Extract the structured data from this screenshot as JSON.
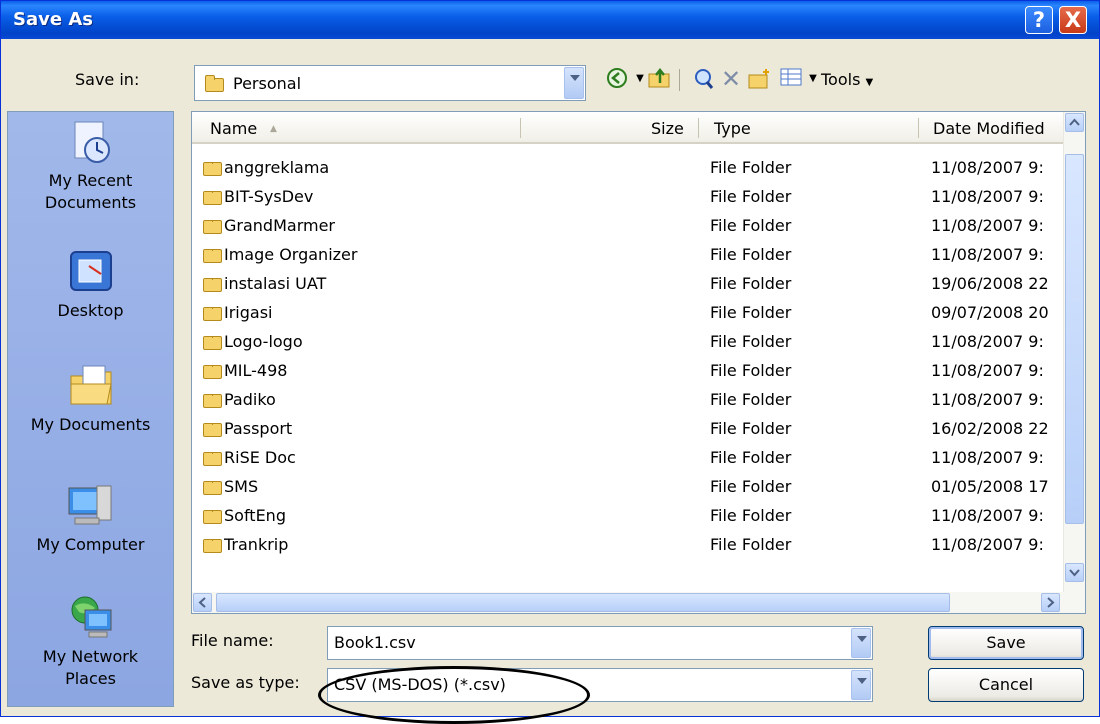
{
  "window": {
    "title": "Save As",
    "help_label": "?",
    "close_label": "X"
  },
  "toolbar": {
    "save_in_label": "Save in:",
    "save_in_value": "Personal",
    "tools_label": "Tools"
  },
  "places": [
    {
      "label_line1": "My Recent",
      "label_line2": "Documents",
      "icon": "recent-documents-icon"
    },
    {
      "label_line1": "Desktop",
      "label_line2": "",
      "icon": "desktop-icon"
    },
    {
      "label_line1": "My Documents",
      "label_line2": "",
      "icon": "my-documents-icon"
    },
    {
      "label_line1": "My Computer",
      "label_line2": "",
      "icon": "my-computer-icon"
    },
    {
      "label_line1": "My Network",
      "label_line2": "Places",
      "icon": "network-places-icon"
    }
  ],
  "list": {
    "columns": {
      "name": "Name",
      "size": "Size",
      "type": "Type",
      "date": "Date Modified"
    },
    "rows": [
      {
        "name": "anggreklama",
        "size": "",
        "type": "File Folder",
        "date": "11/08/2007 9:"
      },
      {
        "name": "BIT-SysDev",
        "size": "",
        "type": "File Folder",
        "date": "11/08/2007 9:"
      },
      {
        "name": "GrandMarmer",
        "size": "",
        "type": "File Folder",
        "date": "11/08/2007 9:"
      },
      {
        "name": "Image Organizer",
        "size": "",
        "type": "File Folder",
        "date": "11/08/2007 9:"
      },
      {
        "name": "instalasi UAT",
        "size": "",
        "type": "File Folder",
        "date": "19/06/2008 22"
      },
      {
        "name": "Irigasi",
        "size": "",
        "type": "File Folder",
        "date": "09/07/2008 20"
      },
      {
        "name": "Logo-logo",
        "size": "",
        "type": "File Folder",
        "date": "11/08/2007 9:"
      },
      {
        "name": "MIL-498",
        "size": "",
        "type": "File Folder",
        "date": "11/08/2007 9:"
      },
      {
        "name": "Padiko",
        "size": "",
        "type": "File Folder",
        "date": "11/08/2007 9:"
      },
      {
        "name": "Passport",
        "size": "",
        "type": "File Folder",
        "date": "16/02/2008 22"
      },
      {
        "name": "RiSE Doc",
        "size": "",
        "type": "File Folder",
        "date": "11/08/2007 9:"
      },
      {
        "name": "SMS",
        "size": "",
        "type": "File Folder",
        "date": "01/05/2008 17"
      },
      {
        "name": "SoftEng",
        "size": "",
        "type": "File Folder",
        "date": "11/08/2007 9:"
      },
      {
        "name": "Trankrip",
        "size": "",
        "type": "File Folder",
        "date": "11/08/2007 9:"
      }
    ]
  },
  "form": {
    "file_name_label": "File name:",
    "file_name_value": "Book1.csv",
    "save_type_label": "Save as type:",
    "save_type_value": "CSV (MS-DOS) (*.csv)"
  },
  "buttons": {
    "save": "Save",
    "cancel": "Cancel"
  },
  "colors": {
    "title_bar": "#0a5fe8",
    "close_button": "#c83a18",
    "places_bar": "#8ca6e2",
    "dialog_bg": "#ece9d8"
  }
}
